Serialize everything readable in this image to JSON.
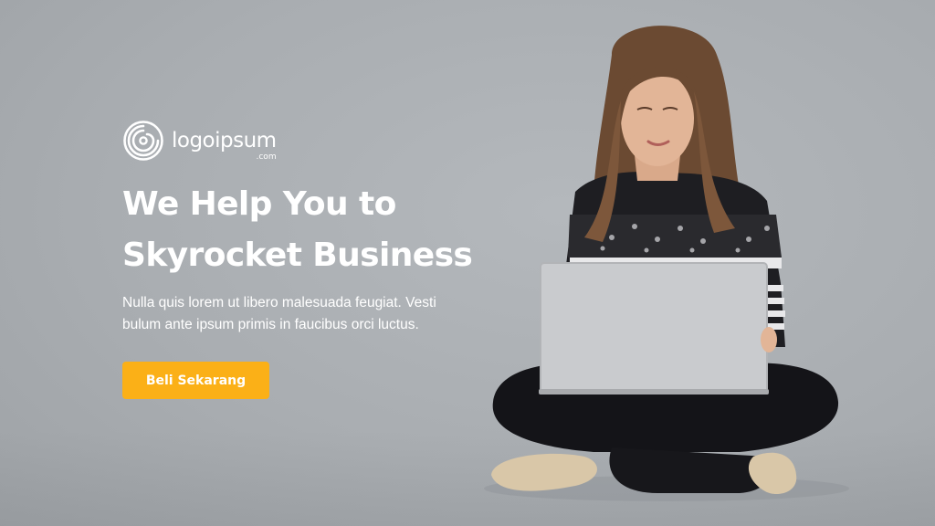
{
  "brand": {
    "name": "logoipsum",
    "suffix": ".com",
    "icon": "spiral-logo-icon"
  },
  "hero": {
    "headline_line1": "We Help You to",
    "headline_line2": "Skyrocket Business",
    "description_line1": "Nulla quis lorem ut libero malesuada feugiat. Vesti",
    "description_line2": "bulum ante ipsum primis in faucibus orci luctus.",
    "cta_label": "Beli Sekarang"
  },
  "colors": {
    "background": "#a9adb1",
    "cta": "#fbb017",
    "text": "#ffffff"
  }
}
